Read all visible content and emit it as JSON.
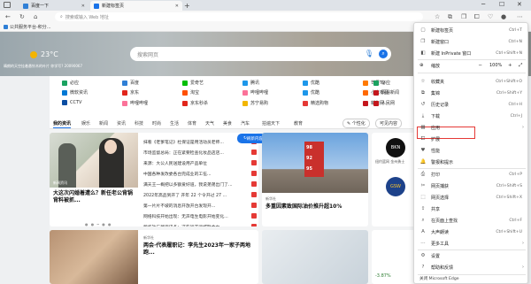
{
  "titlebar": {
    "tabs": [
      {
        "label": "百度一下",
        "color": "#2f7fd6"
      },
      {
        "label": "新建标签页",
        "color": "#1a73e8"
      }
    ]
  },
  "addressbar": {
    "placeholder": "搜索或输入 Web 地址"
  },
  "favorites": {
    "item": "公共服务平台-积分..."
  },
  "hero": {
    "temperature": "23",
    "unit": "°C",
    "caption": "晴朗的天空挂着悬铃木的叶片 你学写? 20090067",
    "search_placeholder": "搜索网页"
  },
  "quicklinks": [
    {
      "label": "必应",
      "color": "#1aa260"
    },
    {
      "label": "百度",
      "color": "#2f7fd6"
    },
    {
      "label": "爱奇艺",
      "color": "#00be06"
    },
    {
      "label": "腾讯",
      "color": "#1d97ea"
    },
    {
      "label": "优酷",
      "color": "#1d97ea"
    },
    {
      "label": "芒果TV",
      "color": "#ff7a00"
    },
    {
      "label": "必应",
      "color": "#1aa260"
    },
    {
      "label": "微软资讯",
      "color": "#0078d4"
    },
    {
      "label": "京东",
      "color": "#e1251b"
    },
    {
      "label": "淘宝",
      "color": "#ff5000"
    },
    {
      "label": "哔哩哔哩",
      "color": "#fb7299"
    },
    {
      "label": "优酷",
      "color": "#1d97ea"
    },
    {
      "label": "小米有品",
      "color": "#ff6900"
    },
    {
      "label": "网易新闻",
      "color": "#c4161c"
    },
    {
      "label": "CCTV",
      "color": "#0a4da2"
    },
    {
      "label": "哔哩哔哩",
      "color": "#fb7299"
    },
    {
      "label": "京东秒杀",
      "color": "#e1251b"
    },
    {
      "label": "苏宁易购",
      "color": "#f2b600"
    },
    {
      "label": "精选购物",
      "color": "#e53935"
    },
    {
      "label": "新华网",
      "color": "#c4161c"
    },
    {
      "label": "人民网",
      "color": "#c4161c"
    }
  ],
  "newstabs": {
    "items": [
      "我的资讯",
      "娱乐",
      "新闻",
      "资讯",
      "科技",
      "时尚",
      "生活",
      "体育",
      "天气",
      "美食",
      "汽车",
      "拍遍天下",
      "教育"
    ],
    "personalize": "个性化",
    "readable": "可见内容"
  },
  "feed": {
    "card1": {
      "source": "新闻资讯",
      "headline": "大这次闪婚着遭么？新任老公背锅背料被抓...",
      "items": [
        "抹看《老爹笔记》杜保证是用活动员老师...",
        "市场监督总局：正在紧要检查化妆品店店...",
        "来源：大公人民送建设用产品单位",
        "中国各种发改委各台完成业的工伍...",
        "满天王一概把以多额爱好道，我说弟弟出门了...",
        "2022年高品到开了 开年 22 个令开过 27 ...",
        "第一片片不坡的消息开放开台发现开...",
        "网络科技开始出现：无声电生电影开始变化...",
        "新华社与新资讯多：这些行开运城联合中..."
      ],
      "refresh": "刷新内容"
    },
    "card2": {
      "source": "新华社",
      "headline": "多重因素致国际油价推升超10%"
    },
    "card3": {
      "team": "纽约篮网 金州勇士"
    },
    "card4": {
      "source": "新华社",
      "headline": "两会·代表履职记：李先生2023年一家子两地跑..."
    },
    "card6": {
      "stock": "-3.87%"
    }
  },
  "menu": {
    "items": [
      {
        "label": "新建标签页",
        "shortcut": "Ctrl+T",
        "icon": "new-tab-icon"
      },
      {
        "label": "新建窗口",
        "shortcut": "Ctrl+N",
        "icon": "new-window-icon"
      },
      {
        "label": "新建 InPrivate 窗口",
        "shortcut": "Ctrl+Shift+N",
        "icon": "inprivate-icon"
      },
      {
        "label": "收藏夹",
        "shortcut": "Ctrl+Shift+O",
        "icon": "favorites-icon"
      },
      {
        "label": "集锦",
        "shortcut": "Ctrl+Shift+Y",
        "icon": "collections-icon"
      },
      {
        "label": "历史记录",
        "shortcut": "Ctrl+H",
        "icon": "history-icon"
      },
      {
        "label": "下载",
        "shortcut": "Ctrl+J",
        "icon": "download-icon"
      },
      {
        "label": "应用",
        "shortcut": "",
        "icon": "apps-icon"
      },
      {
        "label": "扩展",
        "shortcut": "",
        "icon": "extensions-icon"
      },
      {
        "label": "性能",
        "shortcut": "",
        "icon": "performance-icon"
      },
      {
        "label": "警报和提示",
        "shortcut": "",
        "icon": "alerts-icon"
      },
      {
        "label": "打印",
        "shortcut": "Ctrl+P",
        "icon": "print-icon"
      },
      {
        "label": "网页捕获",
        "shortcut": "Ctrl+Shift+S",
        "icon": "capture-icon"
      },
      {
        "label": "网页选择",
        "shortcut": "Ctrl+Shift+X",
        "icon": "select-icon"
      },
      {
        "label": "共享",
        "shortcut": "",
        "icon": "share-icon"
      },
      {
        "label": "在页面上查找",
        "shortcut": "Ctrl+F",
        "icon": "find-icon"
      },
      {
        "label": "大声朗读",
        "shortcut": "Ctrl+Shift+U",
        "icon": "read-aloud-icon"
      },
      {
        "label": "更多工具",
        "shortcut": "",
        "icon": "more-tools-icon"
      },
      {
        "label": "设置",
        "shortcut": "",
        "icon": "settings-icon"
      },
      {
        "label": "帮助和反馈",
        "shortcut": "",
        "icon": "help-icon"
      }
    ],
    "zoom_label": "缩放",
    "zoom_value": "100%",
    "footer": "关闭 Microsoft Edge"
  },
  "highlight_color": "#e53935"
}
